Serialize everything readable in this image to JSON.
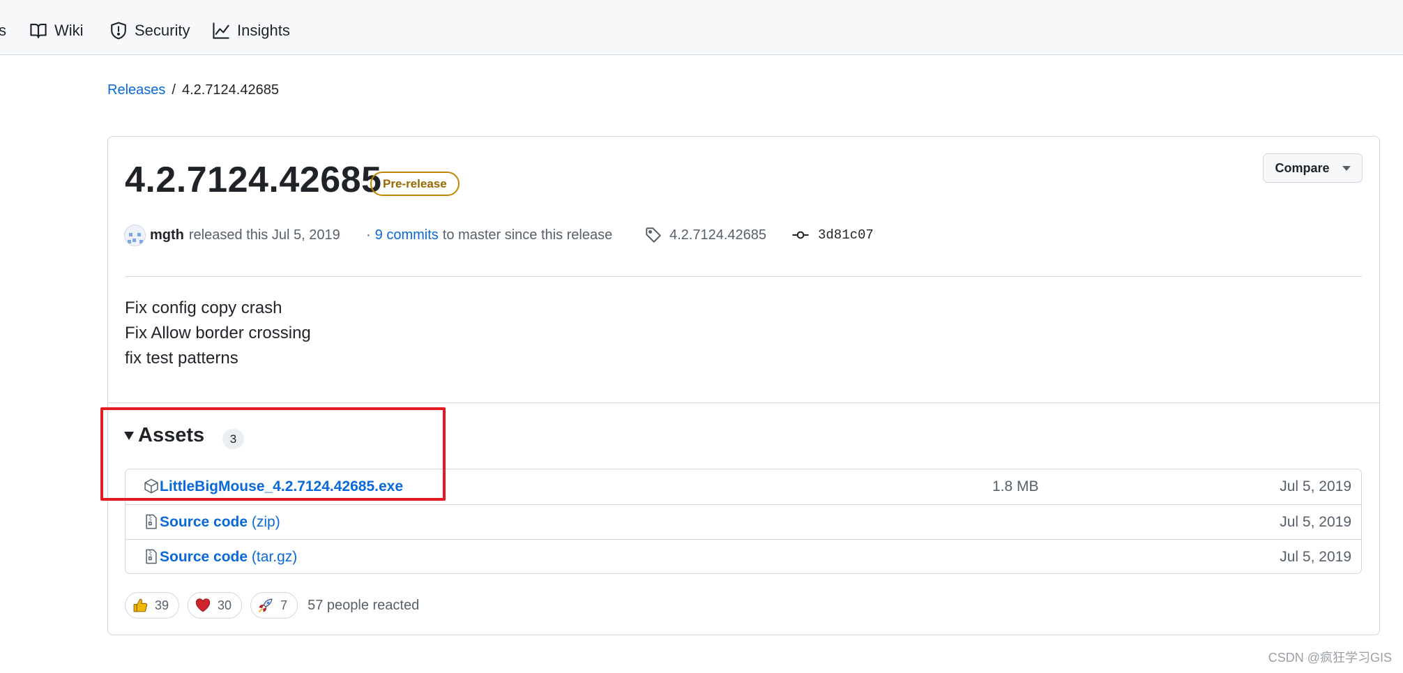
{
  "nav": {
    "partial_left": "s",
    "items": [
      {
        "label": "Wiki",
        "icon": "book-icon"
      },
      {
        "label": "Security",
        "icon": "shield-icon"
      },
      {
        "label": "Insights",
        "icon": "graph-icon"
      }
    ]
  },
  "breadcrumb": {
    "root": "Releases",
    "separator": "/",
    "current": "4.2.7124.42685"
  },
  "release": {
    "title": "4.2.7124.42685",
    "badge": "Pre-release",
    "compare_label": "Compare",
    "author": "mgth",
    "released_text": "released this Jul 5, 2019",
    "commits_prefix": "·",
    "commits_link": "9 commits",
    "commits_suffix": "to master since this release",
    "tag": "4.2.7124.42685",
    "commit_sha": "3d81c07",
    "notes": [
      "Fix config copy crash",
      "Fix Allow border crossing",
      "fix test patterns"
    ]
  },
  "assets": {
    "heading": "Assets",
    "count": "3",
    "rows": [
      {
        "icon": "package-icon",
        "name": "LittleBigMouse_4.2.7124.42685.exe",
        "name_suffix": "",
        "size": "1.8 MB",
        "date": "Jul 5, 2019"
      },
      {
        "icon": "file-zip-icon",
        "name": "Source code",
        "name_suffix": "(zip)",
        "size": "",
        "date": "Jul 5, 2019"
      },
      {
        "icon": "file-zip-icon",
        "name": "Source code",
        "name_suffix": "(tar.gz)",
        "size": "",
        "date": "Jul 5, 2019"
      }
    ]
  },
  "reactions": {
    "items": [
      {
        "emoji": "thumbs-up-icon",
        "count": "39"
      },
      {
        "emoji": "heart-icon",
        "count": "30"
      },
      {
        "emoji": "rocket-icon",
        "count": "7"
      }
    ],
    "summary": "57 people reacted"
  },
  "watermark": "CSDN @疯狂学习GIS",
  "colors": {
    "link": "#0969da",
    "badge_border": "#bf8700",
    "highlight": "#e51b24",
    "heart": "#cf222e",
    "thumb": "#f2b705"
  }
}
